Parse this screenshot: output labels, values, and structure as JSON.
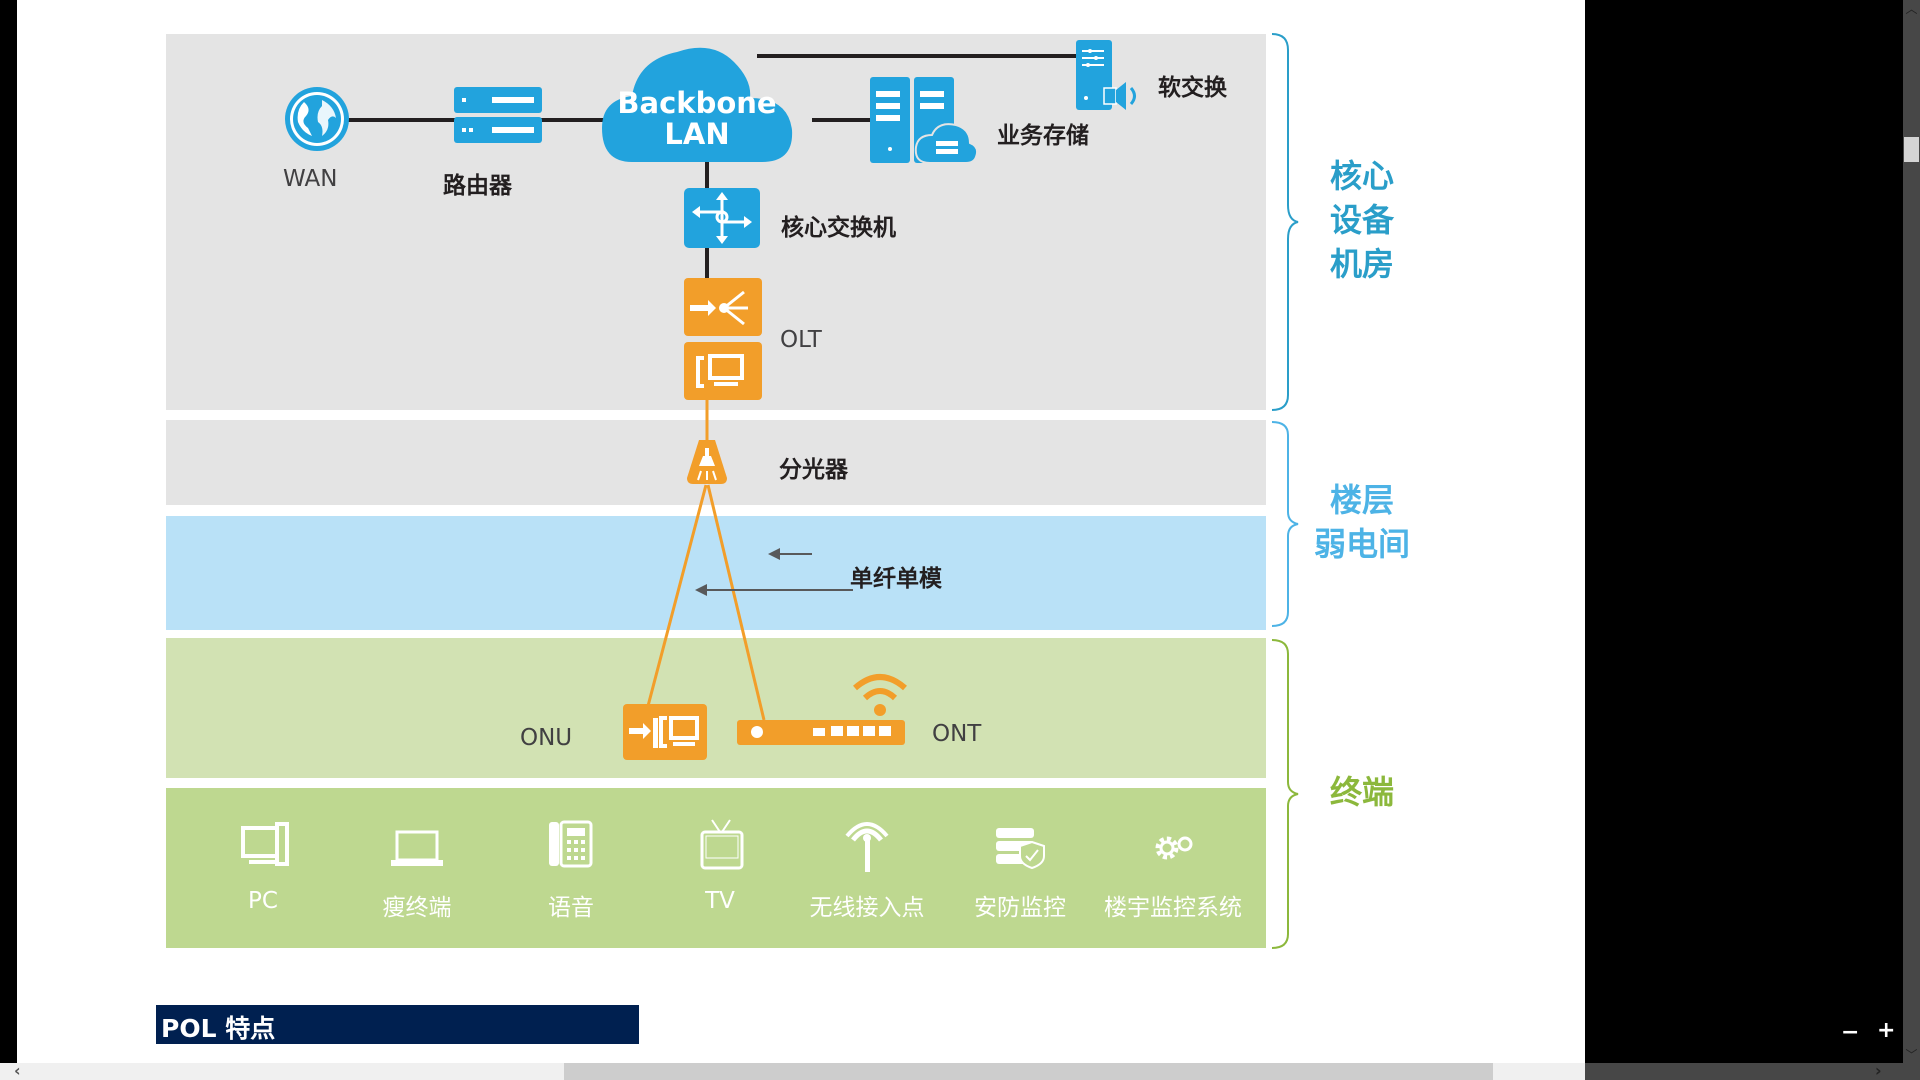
{
  "diagram": {
    "core": {
      "wan_label": "WAN",
      "router_label": "路由器",
      "backbone_line1": "Backbone",
      "backbone_line2": "LAN",
      "storage_label": "业务存储",
      "softswitch_label": "软交换",
      "core_switch_label": "核心交换机",
      "olt_label": "OLT"
    },
    "floor": {
      "splitter_label": "分光器",
      "fiber_label": "单纤单模"
    },
    "terminal": {
      "onu_label": "ONU",
      "ont_label": "ONT",
      "devices": [
        {
          "label": "PC",
          "icon": "pc-icon"
        },
        {
          "label": "瘦终端",
          "icon": "thin-client-icon"
        },
        {
          "label": "语音",
          "icon": "phone-icon"
        },
        {
          "label": "TV",
          "icon": "tv-icon"
        },
        {
          "label": "无线接入点",
          "icon": "wireless-ap-icon"
        },
        {
          "label": "安防监控",
          "icon": "security-monitor-icon"
        },
        {
          "label": "楼宇监控系统",
          "icon": "building-control-icon"
        }
      ]
    },
    "sections": [
      {
        "label": "核心\n设备\n机房",
        "color": "#2a9ec9"
      },
      {
        "label": "楼层\n弱电间",
        "color": "#4db3e6"
      },
      {
        "label": "终端",
        "color": "#8cb83c"
      }
    ],
    "colors": {
      "blue_device": "#22a3dd",
      "orange_device": "#f29e2a",
      "band_gray": "#e4e4e4",
      "band_blue": "#b9e1f7",
      "band_green_light": "#d2e2b3",
      "band_green": "#bed890"
    }
  },
  "section_header": {
    "title": "POL 特点"
  },
  "viewer": {
    "zoom_out": "−",
    "zoom_in": "+"
  }
}
